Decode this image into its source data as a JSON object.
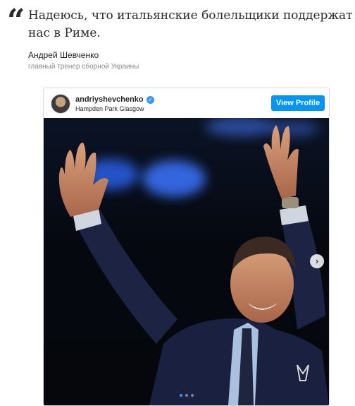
{
  "quote": {
    "text_line1": "Надеюсь, что итальянские болельщики поддержат",
    "text_line2": "нас в Риме."
  },
  "author": {
    "name": "Андрей Шевченко",
    "role": "главный тренер сборной Украины"
  },
  "instagram_embed": {
    "username": "andriyshevchenko",
    "verified": true,
    "location": "Hampden Park Glasgow",
    "view_profile_label": "View Profile",
    "carousel": {
      "total_slides": 3,
      "current_slide": 1
    }
  },
  "colors": {
    "accent_blue": "#0095f6",
    "text_dark": "#2b2b2b",
    "muted": "#8a8a8a"
  }
}
